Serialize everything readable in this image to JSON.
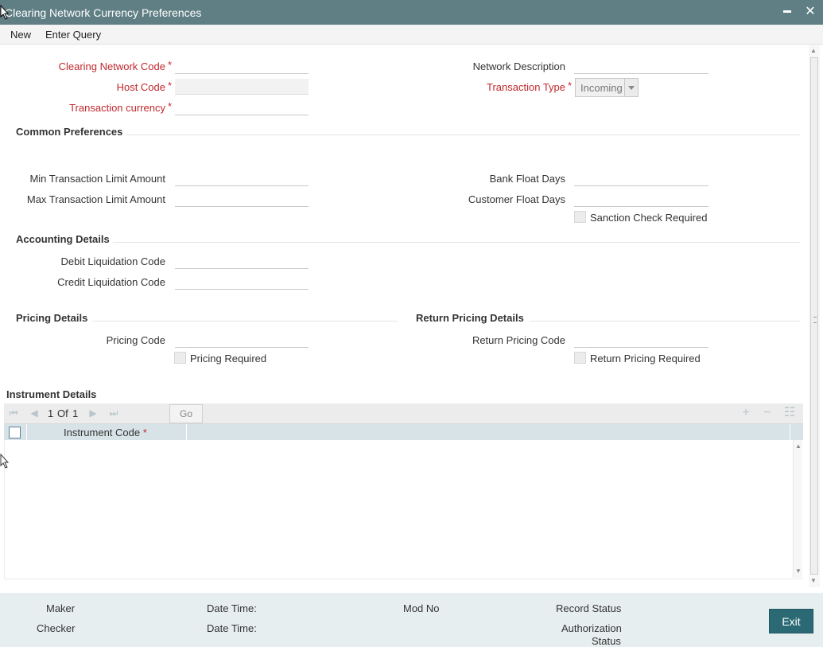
{
  "window": {
    "title": "Clearing Network Currency Preferences"
  },
  "menu": {
    "new": "New",
    "enter_query": "Enter Query"
  },
  "header_fields": {
    "clearing_network_code": {
      "label": "Clearing Network Code",
      "value": ""
    },
    "host_code": {
      "label": "Host Code",
      "value": ""
    },
    "transaction_currency": {
      "label": "Transaction currency",
      "value": ""
    },
    "network_description": {
      "label": "Network Description",
      "value": ""
    },
    "transaction_type": {
      "label": "Transaction Type",
      "value": "Incoming"
    },
    "required_marker": "*"
  },
  "common_preferences": {
    "title": "Common Preferences",
    "min_limit": {
      "label": "Min Transaction Limit Amount",
      "value": ""
    },
    "max_limit": {
      "label": "Max Transaction Limit Amount",
      "value": ""
    },
    "bank_float": {
      "label": "Bank Float Days",
      "value": ""
    },
    "customer_float": {
      "label": "Customer Float Days",
      "value": ""
    },
    "sanction_check": {
      "label": "Sanction Check Required",
      "checked": false
    }
  },
  "accounting_details": {
    "title": "Accounting Details",
    "debit_liq": {
      "label": "Debit Liquidation Code",
      "value": ""
    },
    "credit_liq": {
      "label": "Credit Liquidation Code",
      "value": ""
    }
  },
  "pricing_details": {
    "title": "Pricing Details",
    "pricing_code": {
      "label": "Pricing Code",
      "value": ""
    },
    "pricing_required": {
      "label": "Pricing Required",
      "checked": false
    }
  },
  "return_pricing_details": {
    "title": "Return Pricing Details",
    "return_pricing_code": {
      "label": "Return Pricing Code",
      "value": ""
    },
    "return_pricing_required": {
      "label": "Return Pricing Required",
      "checked": false
    }
  },
  "instrument_details": {
    "title": "Instrument Details",
    "pager": {
      "current": "1",
      "of_label": "Of",
      "total": "1"
    },
    "go_label": "Go",
    "columns": [
      {
        "label": "Instrument Code",
        "required_marker": "*"
      }
    ],
    "rows": []
  },
  "footer": {
    "maker": "Maker",
    "checker": "Checker",
    "date_time_1": "Date Time:",
    "date_time_2": "Date Time:",
    "mod_no": "Mod No",
    "record_status": "Record Status",
    "authorization": "Authorization",
    "status": "Status",
    "exit": "Exit"
  },
  "colors": {
    "titlebar": "#5f7f84",
    "required": "#c1272d",
    "grid_header": "#d7e3e6",
    "footer": "#e7eeef",
    "exit_button": "#2b6a74"
  }
}
